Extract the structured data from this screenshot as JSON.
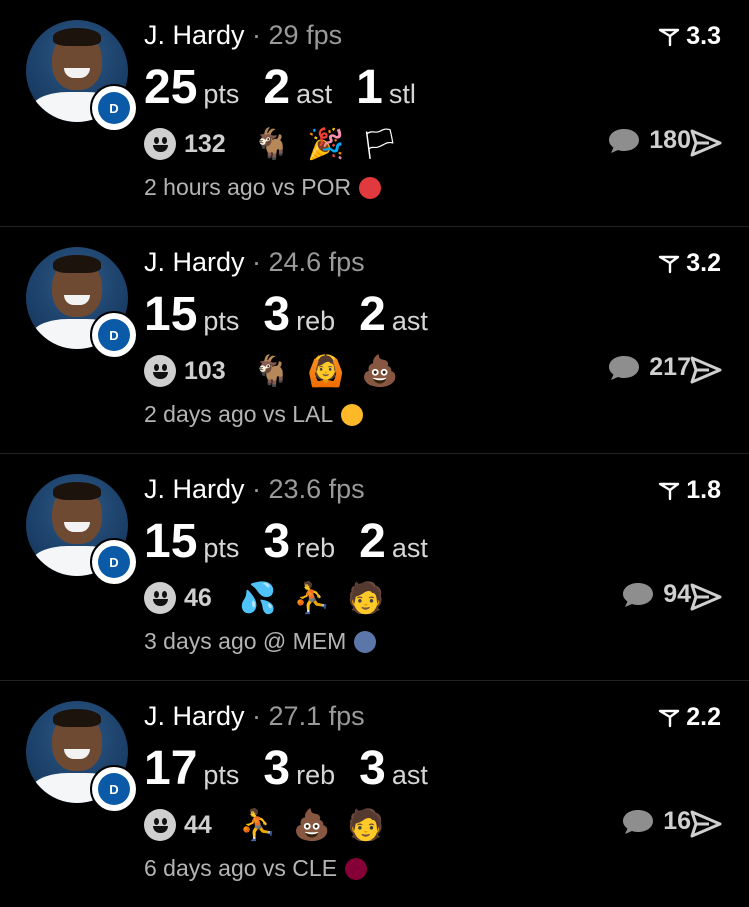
{
  "posts": [
    {
      "player": "J. Hardy",
      "fps": "· 29 fps",
      "rating": "3.3",
      "stats": [
        {
          "value": "25",
          "label": "pts"
        },
        {
          "value": "2",
          "label": "ast"
        },
        {
          "value": "1",
          "label": "stl"
        }
      ],
      "reactions_count": "132",
      "emojis": [
        "goat-emoji",
        "confetti-emoji",
        "flag-emoji"
      ],
      "comments_count": "180",
      "time": "2 hours ago vs POR",
      "opponent_logo": "trail-blazers-logo",
      "opponent_color": "#e03a3e"
    },
    {
      "player": "J. Hardy",
      "fps": "· 24.6 fps",
      "rating": "3.2",
      "stats": [
        {
          "value": "15",
          "label": "pts"
        },
        {
          "value": "3",
          "label": "reb"
        },
        {
          "value": "2",
          "label": "ast"
        }
      ],
      "reactions_count": "103",
      "emojis": [
        "goat-emoji",
        "person-meme-emoji",
        "poop-emoji"
      ],
      "comments_count": "217",
      "time": "2 days ago vs LAL",
      "opponent_logo": "lakers-logo",
      "opponent_color": "#fdb927"
    },
    {
      "player": "J. Hardy",
      "fps": "· 23.6 fps",
      "rating": "1.8",
      "stats": [
        {
          "value": "15",
          "label": "pts"
        },
        {
          "value": "3",
          "label": "reb"
        },
        {
          "value": "2",
          "label": "ast"
        }
      ],
      "reactions_count": "46",
      "emojis": [
        "sweat-droplets-emoji",
        "player-meme-emoji",
        "bald-man-emoji"
      ],
      "comments_count": "94",
      "time": "3 days ago @ MEM",
      "opponent_logo": "grizzlies-logo",
      "opponent_color": "#5d76a9"
    },
    {
      "player": "J. Hardy",
      "fps": "· 27.1 fps",
      "rating": "2.2",
      "stats": [
        {
          "value": "17",
          "label": "pts"
        },
        {
          "value": "3",
          "label": "reb"
        },
        {
          "value": "3",
          "label": "ast"
        }
      ],
      "reactions_count": "44",
      "emojis": [
        "player-meme-emoji",
        "poop-emoji",
        "bald-man-emoji"
      ],
      "comments_count": "16",
      "time": "6 days ago vs CLE",
      "opponent_logo": "cavaliers-logo",
      "opponent_color": "#860038"
    }
  ],
  "team_badge": "mavericks-logo",
  "team_badge_color": "#0b5aa7",
  "icons": {
    "rating": "flag-pennant-icon",
    "reactions": "smiley-icon",
    "comments": "chat-bubble-icon",
    "share": "send-arrow-icon"
  }
}
